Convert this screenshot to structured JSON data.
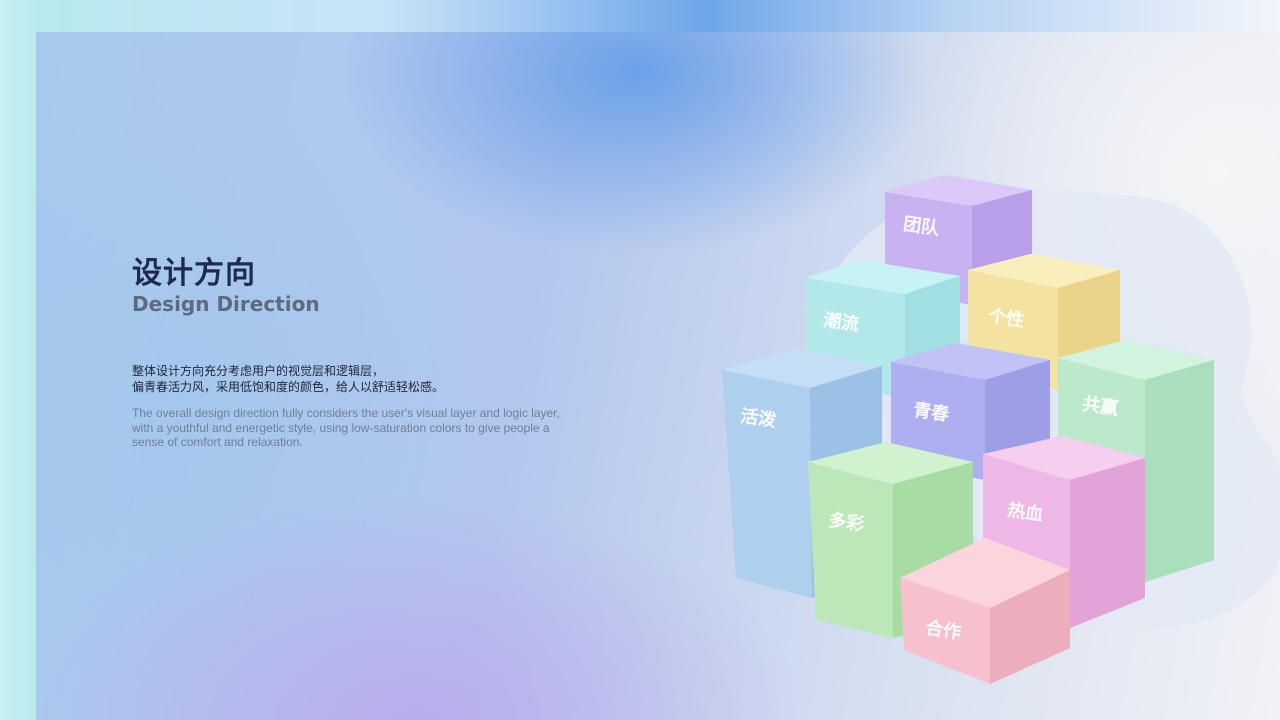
{
  "heading": {
    "title_cn": "设计方向",
    "title_en": "Design Direction"
  },
  "description": {
    "cn_lines": [
      "整体设计方向充分考虑用户的视觉层和逻辑层，",
      "偏青春活力风，采用低饱和度的颜色，给人以舒适轻松感。"
    ],
    "en_lines": [
      "The overall design direction fully considers the user's visual layer and logic layer,",
      "with a youthful and energetic style, using low-saturation colors to give people a",
      " sense of comfort and relaxation."
    ]
  },
  "cubes": [
    {
      "label": "团队",
      "color": "#d3bdf7"
    },
    {
      "label": "潮流",
      "color": "#bdeef0"
    },
    {
      "label": "个性",
      "color": "#f6e7ab"
    },
    {
      "label": "活泼",
      "color": "#b7d6f2"
    },
    {
      "label": "青春",
      "color": "#b6b7f2"
    },
    {
      "label": "共赢",
      "color": "#c3ecd2"
    },
    {
      "label": "多彩",
      "color": "#c4ecc2"
    },
    {
      "label": "热血",
      "color": "#f2c2ea"
    },
    {
      "label": "合作",
      "color": "#f8c8d3"
    }
  ],
  "colors": {
    "title": "#1c2a55",
    "subtitle": "#5d6b7f",
    "body_cn": "#1f2637",
    "body_en": "#6f7f97"
  }
}
